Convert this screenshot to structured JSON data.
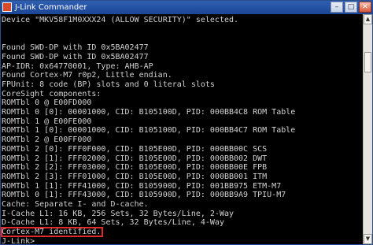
{
  "window": {
    "title": "J-Link Commander"
  },
  "console_lines": [
    "Device \"MKV58F1M0XXX24 (ALLOW SECURITY)\" selected.",
    "",
    "",
    "Found SWD-DP with ID 0x5BA02477",
    "Found SWD-DP with ID 0x5BA02477",
    "AP-IDR: 0x64770001, Type: AHB-AP",
    "Found Cortex-M7 r0p2, Little endian.",
    "FPUnit: 8 code (BP) slots and 0 literal slots",
    "CoreSight components:",
    "ROMTbl 0 @ E00FD000",
    "ROMTbl 0 [0]: 00001000, CID: B105100D, PID: 000BB4C8 ROM Table",
    "ROMTbl 1 @ E00FE000",
    "ROMTbl 1 [0]: 00001000, CID: B105100D, PID: 000BB4C7 ROM Table",
    "ROMTbl 2 @ E00FF000",
    "ROMTbl 2 [0]: FFF0F000, CID: B105E00D, PID: 000BB00C SCS",
    "ROMTbl 2 [1]: FFF02000, CID: B105E00D, PID: 000BB002 DWT",
    "ROMTbl 2 [2]: FFF03000, CID: B105E00D, PID: 000BB00E FPB",
    "ROMTbl 2 [3]: FFF01000, CID: B105E00D, PID: 000BB001 ITM",
    "ROMTbl 1 [1]: FFF41000, CID: B105900D, PID: 001BB975 ETM-M7",
    "ROMTbl 0 [1]: FFF43000, CID: B105900D, PID: 000BB9A9 TPIU-M7",
    "Cache: Separate I- and D-cache.",
    "I-Cache L1: 16 KB, 256 Sets, 32 Bytes/Line, 2-Way",
    "D-Cache L1: 8 KB, 64 Sets, 32 Bytes/Line, 4-Way",
    "Cortex-M7 identified.",
    "J-Link>"
  ]
}
